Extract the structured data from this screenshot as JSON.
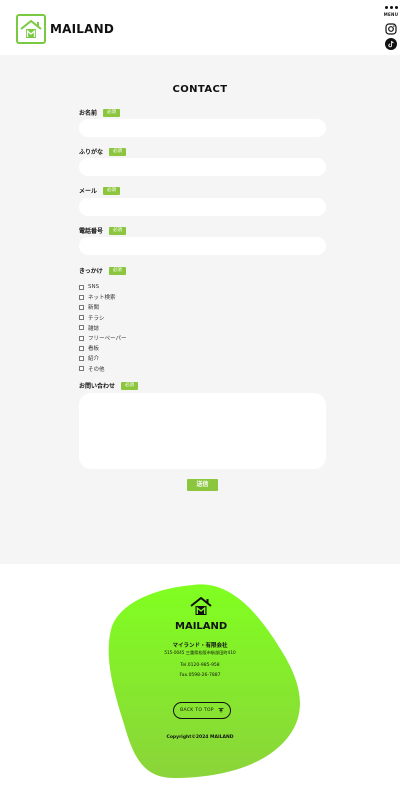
{
  "header": {
    "brand": "MAILAND",
    "menu_label": "MENU",
    "social_icons": [
      "instagram-icon",
      "tiktok-icon"
    ]
  },
  "form": {
    "title": "CONTACT",
    "required_badge": "必須",
    "fields": [
      {
        "label": "お名前",
        "value": "",
        "placeholder": ""
      },
      {
        "label": "ふりがな",
        "value": "",
        "placeholder": ""
      },
      {
        "label": "メール",
        "value": "",
        "placeholder": ""
      },
      {
        "label": "電話番号",
        "value": "",
        "placeholder": ""
      }
    ],
    "trigger": {
      "label": "きっかけ",
      "options": [
        "SNS",
        "ネット検索",
        "新聞",
        "チラシ",
        "雑誌",
        "フリーペーパー",
        "看板",
        "紹介",
        "その他"
      ]
    },
    "message": {
      "label": "お問い合わせ",
      "value": ""
    },
    "submit_label": "送信"
  },
  "footer": {
    "brand": "MAILAND",
    "company": "マイランド・有限会社",
    "address": "515-0045 三重県松阪市駅部田町410",
    "tel": "Tel.0120-985-958",
    "fax": "Fax.0598-26-7887",
    "back_to_top": "BACK TO TOP",
    "copyright": "Copyright©2024 MAILAND"
  },
  "colors": {
    "accent": "#8cc63f",
    "blob_top": "#80ff20",
    "blob_bottom": "#8bd43a",
    "form_bg": "#f5f5f5"
  }
}
